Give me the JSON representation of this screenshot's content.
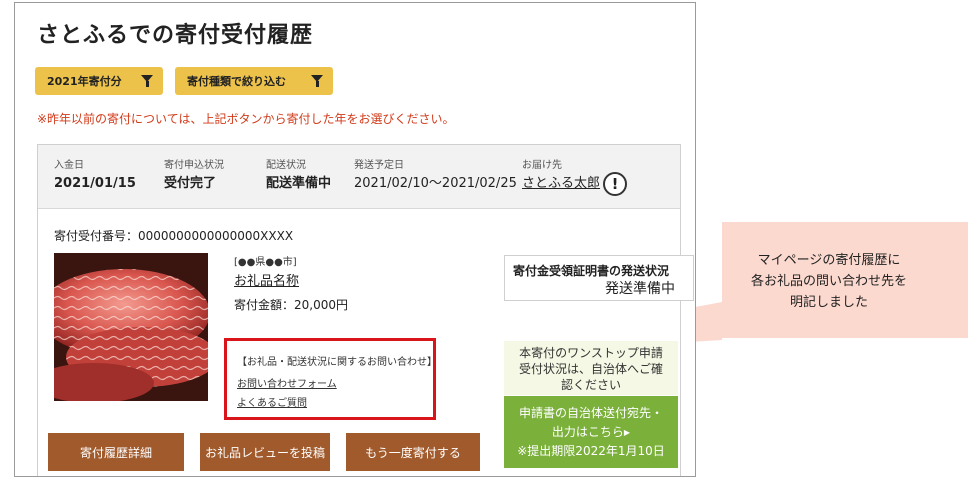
{
  "page": {
    "title": "さとふるでの寄付受付履歴"
  },
  "filters": {
    "year_label": "2021年寄付分",
    "type_label": "寄付種類で絞り込む"
  },
  "notice": "※昨年以前の寄付については、上記ボタンから寄付した年をお選びください。",
  "order": {
    "payment_date_label": "入金日",
    "payment_date": "2021/01/15",
    "application_status_label": "寄付申込状況",
    "application_status": "受付完了",
    "shipping_status_label": "配送状況",
    "shipping_status": "配送準備中",
    "ship_date_label": "発送予定日",
    "ship_date": "2021/02/10〜2021/02/25",
    "recipient_label": "お届け先",
    "recipient": "さとふる太郎",
    "info_icon": "!",
    "receipt_number": "寄付受付番号：0000000000000000XXXX",
    "region": "[●●県●●市]",
    "item_name": "お礼品名称",
    "amount": "寄付金額：20,000円"
  },
  "contact": {
    "title": "【お礼品・配送状況に関するお問い合わせ】",
    "form_link": "お問い合わせフォーム",
    "faq_link": "よくあるご質問"
  },
  "certificate": {
    "title": "寄付金受領証明書の発送状況",
    "status": "発送準備中"
  },
  "onestop": {
    "line1": "本寄付のワンストップ申請",
    "line2": "受付状況は、自治体へご確",
    "line3": "認ください"
  },
  "application_button": {
    "line1": "申請書の自治体送付宛先・",
    "line2": "出力はこちら",
    "arrow": "▶",
    "line3": "※提出期限2022年1月10日"
  },
  "actions": {
    "history_detail": "寄付履歴詳細",
    "post_review": "お礼品レビューを投稿",
    "donate_again": "もう一度寄付する"
  },
  "callout": {
    "line1": "マイページの寄付履歴に",
    "line2": "各お礼品の問い合わせ先を",
    "line3": "明記しました"
  },
  "icons": {
    "filter": "funnel-icon",
    "info": "exclamation-circle-icon"
  },
  "colors": {
    "filter_button": "#ecc24a",
    "notice": "#d23a1a",
    "action_button": "#a05a2c",
    "green_button": "#7bb13b",
    "highlight_border": "#d9141a",
    "callout_fill": "#fbd9cf"
  }
}
